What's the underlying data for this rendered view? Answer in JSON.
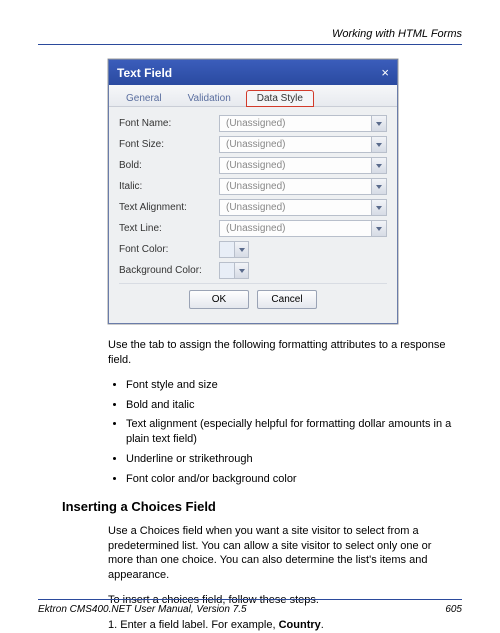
{
  "header": {
    "chapter_title": "Working with HTML Forms"
  },
  "dialog": {
    "title": "Text Field",
    "close_glyph": "×",
    "tabs": [
      {
        "label": "General",
        "active": false
      },
      {
        "label": "Validation",
        "active": false
      },
      {
        "label": "Data Style",
        "active": true
      }
    ],
    "fields": {
      "font_name": {
        "label": "Font Name:",
        "value": "(Unassigned)"
      },
      "font_size": {
        "label": "Font Size:",
        "value": "(Unassigned)"
      },
      "bold": {
        "label": "Bold:",
        "value": "(Unassigned)"
      },
      "italic": {
        "label": "Italic:",
        "value": "(Unassigned)"
      },
      "text_align": {
        "label": "Text Alignment:",
        "value": "(Unassigned)"
      },
      "text_line": {
        "label": "Text Line:",
        "value": "(Unassigned)"
      },
      "font_color": {
        "label": "Font Color:"
      },
      "bg_color": {
        "label": "Background Color:"
      }
    },
    "buttons": {
      "ok": "OK",
      "cancel": "Cancel"
    }
  },
  "body": {
    "intro": "Use the tab to assign the following formatting attributes to a response field.",
    "bullets": [
      "Font style and size",
      "Bold and italic",
      "Text alignment (especially helpful for formatting dollar amounts in a plain text field)",
      "Underline or strikethrough",
      "Font color and/or background color"
    ],
    "section_heading": "Inserting a Choices Field",
    "section_para": "Use a Choices field when you want a site visitor to select from a predetermined list. You can allow a site visitor to select only one or more than one choice. You can also determine the list's items and appearance.",
    "steps_intro": "To insert a choices field, follow these steps.",
    "step1_prefix": "1.   Enter a field label. For example, ",
    "step1_bold": "Country",
    "step1_suffix": "."
  },
  "footer": {
    "manual": "Ektron CMS400.NET User Manual, Version 7.5",
    "page": "605"
  }
}
